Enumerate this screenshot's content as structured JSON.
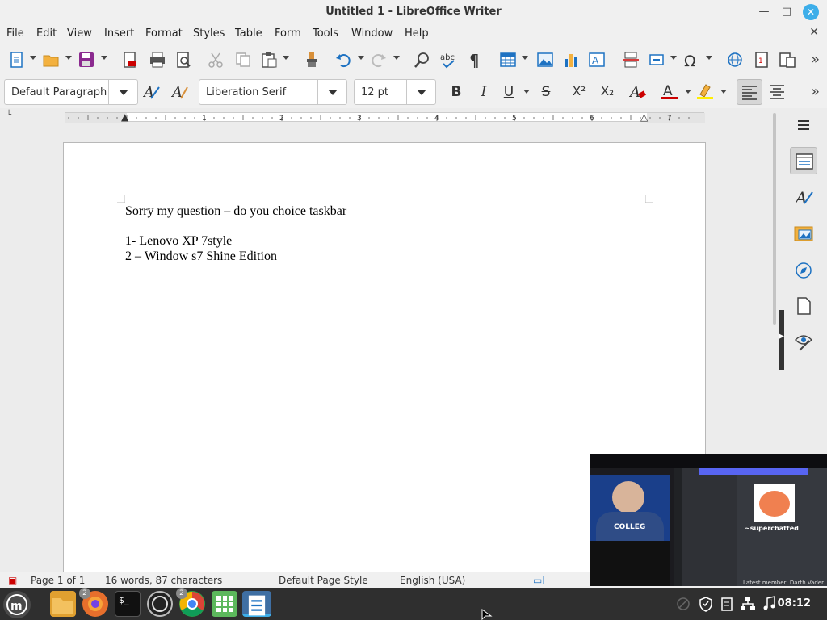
{
  "window": {
    "title": "Untitled 1 - LibreOffice Writer"
  },
  "menu": [
    "File",
    "Edit",
    "View",
    "Insert",
    "Format",
    "Styles",
    "Table",
    "Form",
    "Tools",
    "Window",
    "Help"
  ],
  "formatting": {
    "paragraph_style": "Default Paragraph",
    "font_name": "Liberation Serif",
    "font_size": "12 pt",
    "bold": "B",
    "italic": "I",
    "underline": "U",
    "strike": "S",
    "superscript": "X²",
    "subscript": "X₂"
  },
  "ruler": {
    "labels": [
      "1",
      "2",
      "3",
      "4",
      "5",
      "6",
      "7"
    ]
  },
  "document": {
    "lines": [
      "Sorry my question – do you choice taskbar",
      "1- Lenovo XP 7style",
      "2 – Window s7 Shine Edition"
    ]
  },
  "status": {
    "page": "Page 1 of 1",
    "words": "16 words, 87 characters",
    "page_style": "Default Page Style",
    "language": "English (USA)"
  },
  "taskbar": {
    "badges": [
      "2",
      "2"
    ],
    "clock": "08:12"
  },
  "pip": {
    "chat_line": "~superchatted",
    "footer": "Latest member: Darth Vader",
    "stream_text": "COLLEG"
  },
  "colors": {
    "accent": "#3daee9",
    "font_color": "#cc0000",
    "highlight": "#ffee00",
    "taskbar": "#2f2f2f"
  }
}
